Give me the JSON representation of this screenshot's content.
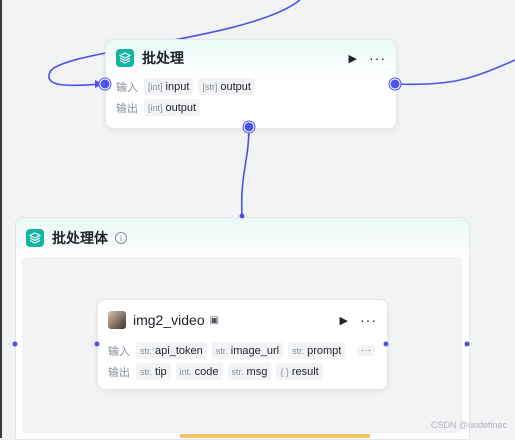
{
  "colors": {
    "accent": "#4d53e8",
    "node_icon": "#12b5a5",
    "muted": "#86909c"
  },
  "batch_node": {
    "title": "批处理",
    "icon": "layers-icon",
    "input_label": "输入",
    "output_label": "输出",
    "inputs": [
      {
        "type": "[int]",
        "name": "input"
      },
      {
        "type": "[str]",
        "name": "output"
      }
    ],
    "outputs": [
      {
        "type": "[int]",
        "name": "output"
      }
    ]
  },
  "batch_body": {
    "title": "批处理体",
    "icon": "layers-icon"
  },
  "img_node": {
    "title": "img2_video",
    "icon": "avatar",
    "input_label": "输入",
    "output_label": "输出",
    "more_inputs": "···",
    "inputs": [
      {
        "type": "str.",
        "name": "api_token"
      },
      {
        "type": "str.",
        "name": "image_url"
      },
      {
        "type": "str.",
        "name": "prompt"
      }
    ],
    "outputs": [
      {
        "type": "str.",
        "name": "tip"
      },
      {
        "type": "int.",
        "name": "code"
      },
      {
        "type": "str.",
        "name": "msg"
      },
      {
        "type": "{ }",
        "name": "result"
      }
    ]
  },
  "watermark": "CSDN @undefinec"
}
